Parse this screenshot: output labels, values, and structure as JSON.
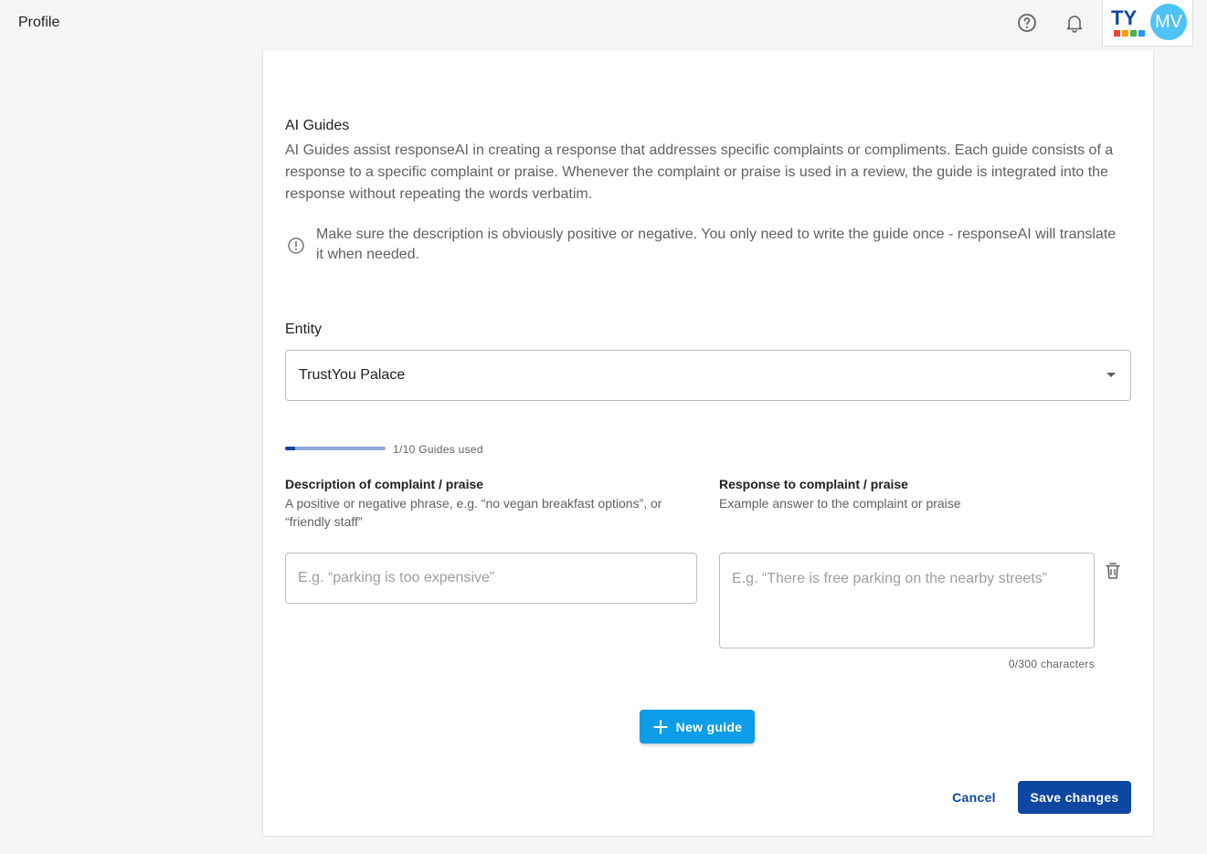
{
  "header": {
    "title": "Profile",
    "help_icon": "help-circle-icon",
    "notification_icon": "bell-icon",
    "logo_text": "TY",
    "logo_colors": [
      "#f44336",
      "#ff9800",
      "#4caf50",
      "#2196f3"
    ],
    "avatar_initials": "MV",
    "avatar_color": "#4fc3f7"
  },
  "ai_guides": {
    "title": "AI Guides",
    "description": "AI Guides assist responseAI in creating a response that addresses specific complaints or compliments. Each guide consists of a response to a specific complaint or praise. Whenever the complaint or praise is used in a review, the guide is integrated into the response without repeating the words verbatim.",
    "hint": "Make sure the description is obviously positive or negative. You only need to write the guide once - responseAI will translate it when needed."
  },
  "entity": {
    "label": "Entity",
    "selected": "TrustYou Palace"
  },
  "usage": {
    "used": 1,
    "total": 10,
    "text": "1/10 Guides used"
  },
  "guide_form": {
    "description_heading": "Description of complaint / praise",
    "description_sub": "A positive or negative phrase, e.g. “no vegan breakfast options”, or “friendly staff”",
    "description_placeholder": "E.g. “parking is too expensive”",
    "description_value": "",
    "response_heading": "Response to complaint / praise",
    "response_sub": "Example answer to the complaint or praise",
    "response_placeholder": "E.g. “There is free parking on the nearby streets”",
    "response_value": "",
    "char_count": "0/300 characters",
    "delete_icon": "trash-icon"
  },
  "actions": {
    "new_guide_label": "New guide",
    "cancel_label": "Cancel",
    "save_label": "Save changes"
  },
  "colors": {
    "primary": "#0d47a1",
    "accent": "#0d9de8"
  }
}
